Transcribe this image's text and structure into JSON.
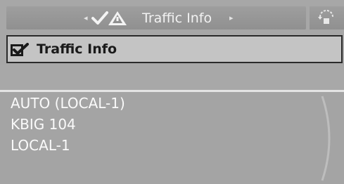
{
  "header": {
    "title": "Traffic Info",
    "icon": "traffic-warning-icon",
    "prev_icon": "left-arrow-icon",
    "next_icon": "right-arrow-icon"
  },
  "corner_button": {
    "icon": "menu-options-icon"
  },
  "selected_item": {
    "icon": "checkbox-checked-icon",
    "label": "Traffic Info"
  },
  "list": {
    "items": [
      {
        "label": "AUTO (LOCAL-1)"
      },
      {
        "label": "KBIG 104"
      },
      {
        "label": "LOCAL-1"
      }
    ]
  },
  "colors": {
    "panel": "#a7a7a7",
    "header": "#909090",
    "selected_bg": "#c4c4c4",
    "selected_border": "#2a2a2a",
    "text_light": "#fafafa"
  }
}
